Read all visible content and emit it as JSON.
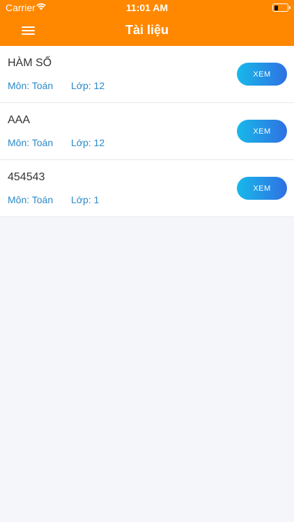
{
  "status_bar": {
    "carrier": "Carrier",
    "time": "11:01 AM",
    "battery_level": 0.3
  },
  "nav": {
    "title": "Tài liệu",
    "menu_icon": "hamburger-menu-icon"
  },
  "labels": {
    "subject_prefix": "Môn: ",
    "grade_prefix": "Lớp: ",
    "view_button": "XEM"
  },
  "documents": [
    {
      "title": "HÀM SỐ",
      "subject": "Môn: Toán",
      "grade": "Lớp: 12",
      "button": "XEM"
    },
    {
      "title": "AAA",
      "subject": "Môn: Toán",
      "grade": "Lớp: 12",
      "button": "XEM"
    },
    {
      "title": "454543",
      "subject": "Môn: Toán",
      "grade": "Lớp: 1",
      "button": "XEM"
    }
  ],
  "colors": {
    "header": "#ff8800",
    "link_text": "#2a88c8",
    "button_gradient_start": "#18b9ea",
    "button_gradient_end": "#2f70e2",
    "background": "#f4f6f9"
  }
}
